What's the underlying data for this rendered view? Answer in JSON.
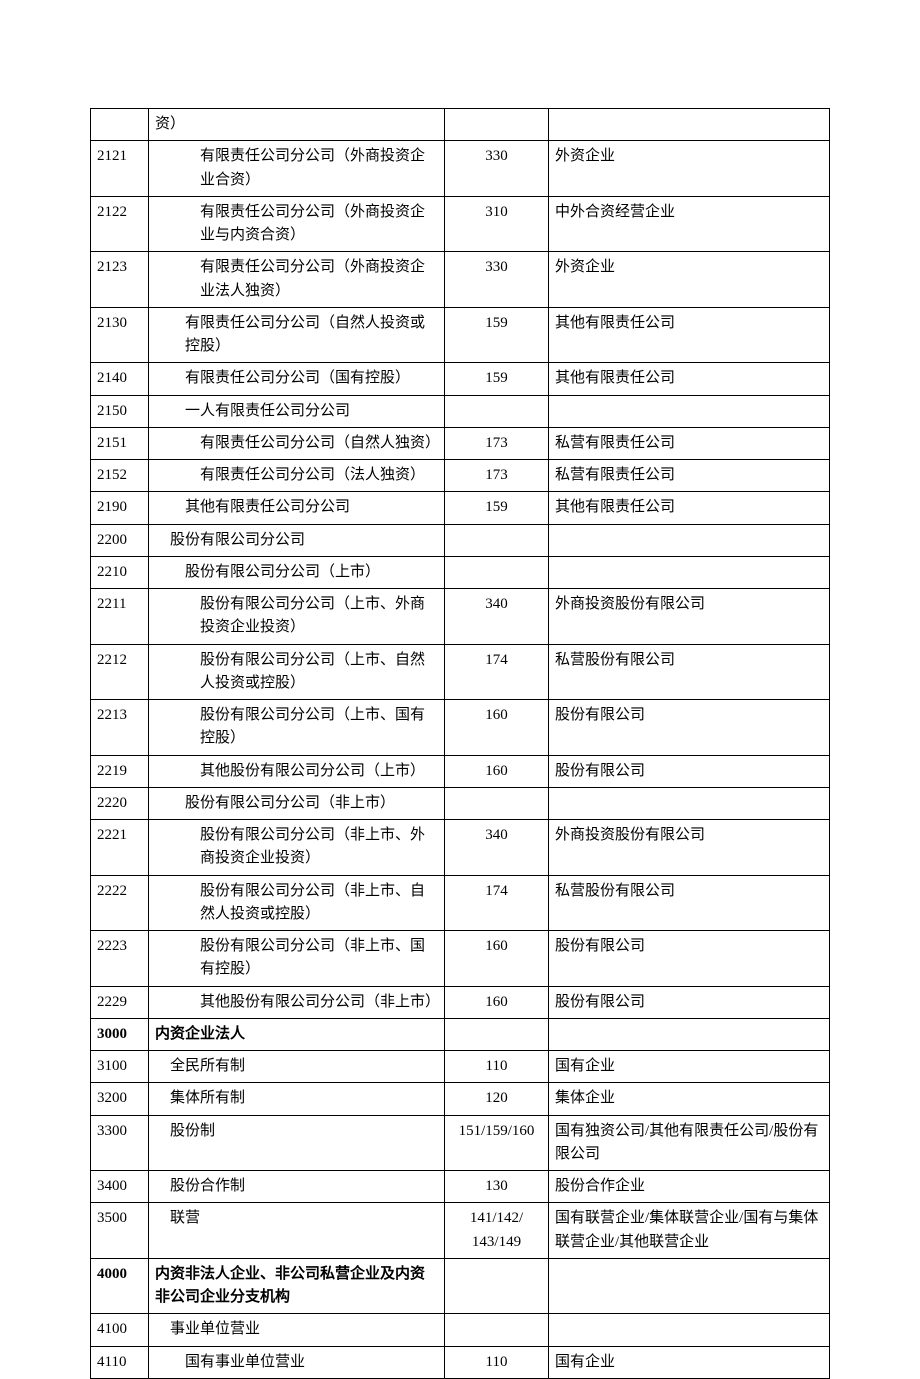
{
  "rows": [
    {
      "code": "",
      "desc": "资）",
      "indent": 0,
      "num": "",
      "remark": ""
    },
    {
      "code": "2121",
      "desc": "有限责任公司分公司（外商投资企业合资）",
      "indent": 3,
      "num": "330",
      "remark": "外资企业"
    },
    {
      "code": "2122",
      "desc": "有限责任公司分公司（外商投资企业与内资合资）",
      "indent": 3,
      "num": "310",
      "remark": "中外合资经营企业"
    },
    {
      "code": "2123",
      "desc": "有限责任公司分公司（外商投资企业法人独资）",
      "indent": 3,
      "num": "330",
      "remark": "外资企业"
    },
    {
      "code": "2130",
      "desc": "有限责任公司分公司（自然人投资或控股）",
      "indent": 2,
      "num": "159",
      "remark": "其他有限责任公司"
    },
    {
      "code": "2140",
      "desc": "有限责任公司分公司（国有控股）",
      "indent": 2,
      "num": "159",
      "remark": "其他有限责任公司"
    },
    {
      "code": "2150",
      "desc": "一人有限责任公司分公司",
      "indent": 2,
      "num": "",
      "remark": ""
    },
    {
      "code": "2151",
      "desc": "有限责任公司分公司（自然人独资）",
      "indent": 3,
      "num": "173",
      "remark": "私营有限责任公司"
    },
    {
      "code": "2152",
      "desc": "有限责任公司分公司（法人独资）",
      "indent": 3,
      "num": "173",
      "remark": "私营有限责任公司"
    },
    {
      "code": "2190",
      "desc": "其他有限责任公司分公司",
      "indent": 2,
      "num": "159",
      "remark": "其他有限责任公司"
    },
    {
      "code": "2200",
      "desc": "股份有限公司分公司",
      "indent": 1,
      "num": "",
      "remark": ""
    },
    {
      "code": "2210",
      "desc": "股份有限公司分公司（上市）",
      "indent": 2,
      "num": "",
      "remark": ""
    },
    {
      "code": "2211",
      "desc": "股份有限公司分公司（上市、外商投资企业投资）",
      "indent": 3,
      "num": "340",
      "remark": "外商投资股份有限公司"
    },
    {
      "code": "2212",
      "desc": "股份有限公司分公司（上市、自然人投资或控股）",
      "indent": 3,
      "num": "174",
      "remark": "私营股份有限公司"
    },
    {
      "code": "2213",
      "desc": "股份有限公司分公司（上市、国有控股）",
      "indent": 3,
      "num": "160",
      "remark": "股份有限公司"
    },
    {
      "code": "2219",
      "desc": "其他股份有限公司分公司（上市）",
      "indent": 3,
      "num": "160",
      "remark": "股份有限公司"
    },
    {
      "code": "2220",
      "desc": "股份有限公司分公司（非上市）",
      "indent": 2,
      "num": "",
      "remark": ""
    },
    {
      "code": "2221",
      "desc": "股份有限公司分公司（非上市、外商投资企业投资）",
      "indent": 3,
      "num": "340",
      "remark": "外商投资股份有限公司"
    },
    {
      "code": "2222",
      "desc": "股份有限公司分公司（非上市、自然人投资或控股）",
      "indent": 3,
      "num": "174",
      "remark": "私营股份有限公司"
    },
    {
      "code": "2223",
      "desc": "股份有限公司分公司（非上市、国有控股）",
      "indent": 3,
      "num": "160",
      "remark": "股份有限公司"
    },
    {
      "code": "2229",
      "desc": "其他股份有限公司分公司（非上市）",
      "indent": 3,
      "num": "160",
      "remark": "股份有限公司"
    },
    {
      "code": "3000",
      "desc": "内资企业法人",
      "indent": 0,
      "num": "",
      "remark": "",
      "bold": true
    },
    {
      "code": "3100",
      "desc": "全民所有制",
      "indent": 1,
      "num": "110",
      "remark": "国有企业"
    },
    {
      "code": "3200",
      "desc": "集体所有制",
      "indent": 1,
      "num": "120",
      "remark": "集体企业"
    },
    {
      "code": "3300",
      "desc": "股份制",
      "indent": 1,
      "num": "151/159/160",
      "remark": "国有独资公司/其他有限责任公司/股份有限公司"
    },
    {
      "code": "3400",
      "desc": "股份合作制",
      "indent": 1,
      "num": "130",
      "remark": "股份合作企业"
    },
    {
      "code": "3500",
      "desc": "联营",
      "indent": 1,
      "num": "141/142/ 143/149",
      "remark": "国有联营企业/集体联营企业/国有与集体联营企业/其他联营企业"
    },
    {
      "code": "4000",
      "desc": "内资非法人企业、非公司私营企业及内资非公司企业分支机构",
      "indent": 0,
      "num": "",
      "remark": "",
      "bold": true
    },
    {
      "code": "4100",
      "desc": "事业单位营业",
      "indent": 1,
      "num": "",
      "remark": ""
    },
    {
      "code": "4110",
      "desc": "国有事业单位营业",
      "indent": 2,
      "num": "110",
      "remark": "国有企业"
    }
  ]
}
